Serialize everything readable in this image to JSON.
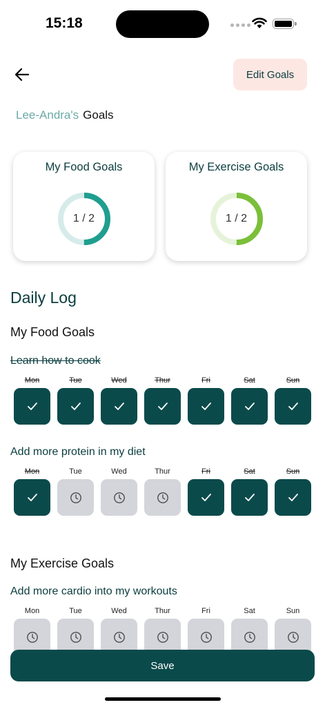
{
  "status": {
    "time": "15:18"
  },
  "header": {
    "edit_label": "Edit Goals"
  },
  "owner": {
    "name": "Lee-Andra's",
    "suffix": "Goals"
  },
  "summary": {
    "food": {
      "title": "My Food Goals",
      "completed": 1,
      "total": 2,
      "label": "1 / 2",
      "color": "#1f9e8f",
      "track": "#d6ecea"
    },
    "exercise": {
      "title": "My Exercise Goals",
      "completed": 1,
      "total": 2,
      "label": "1 / 2",
      "color": "#7bbf3a",
      "track": "#e6f3da"
    }
  },
  "daily_log": {
    "title": "Daily Log",
    "food_section": "My Food Goals",
    "exercise_section": "My Exercise Goals",
    "goals": [
      {
        "title": "Learn how to cook",
        "completed": true,
        "days": [
          {
            "label": "Mon",
            "status": "done"
          },
          {
            "label": "Tue",
            "status": "done"
          },
          {
            "label": "Wed",
            "status": "done"
          },
          {
            "label": "Thur",
            "status": "done"
          },
          {
            "label": "Fri",
            "status": "done"
          },
          {
            "label": "Sat",
            "status": "done"
          },
          {
            "label": "Sun",
            "status": "done"
          }
        ]
      },
      {
        "title": "Add more protein in my diet",
        "completed": false,
        "days": [
          {
            "label": "Mon",
            "status": "done"
          },
          {
            "label": "Tue",
            "status": "pending"
          },
          {
            "label": "Wed",
            "status": "pending"
          },
          {
            "label": "Thur",
            "status": "pending"
          },
          {
            "label": "Fri",
            "status": "done"
          },
          {
            "label": "Sat",
            "status": "done"
          },
          {
            "label": "Sun",
            "status": "done"
          }
        ]
      },
      {
        "title": "Add more cardio into my workouts",
        "completed": false,
        "days": [
          {
            "label": "Mon",
            "status": "pending"
          },
          {
            "label": "Tue",
            "status": "pending"
          },
          {
            "label": "Wed",
            "status": "pending"
          },
          {
            "label": "Thur",
            "status": "pending"
          },
          {
            "label": "Fri",
            "status": "pending"
          },
          {
            "label": "Sat",
            "status": "pending"
          },
          {
            "label": "Sun",
            "status": "pending"
          }
        ]
      }
    ]
  },
  "footer": {
    "save_label": "Save"
  },
  "icons": {
    "back": "arrow-left-icon",
    "done": "check-icon",
    "pending": "clock-icon"
  }
}
